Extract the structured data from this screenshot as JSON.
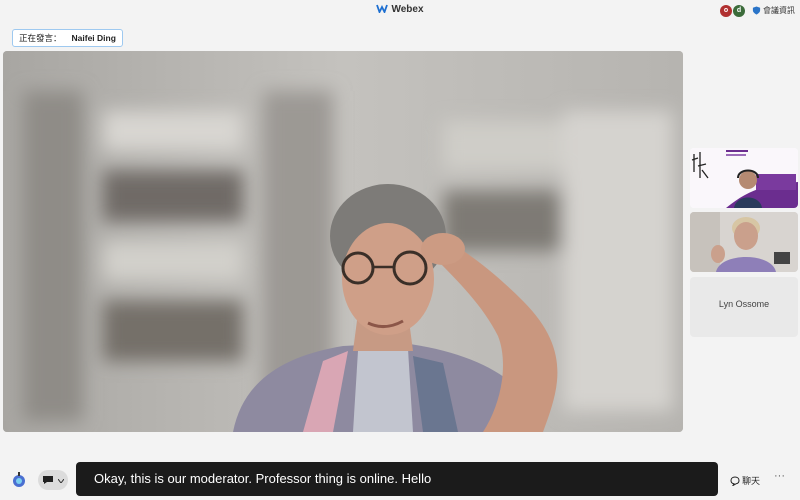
{
  "app": {
    "title": "Webex"
  },
  "header": {
    "avatars": [
      {
        "initial": "o",
        "color": "#b03030"
      },
      {
        "initial": "d",
        "color": "#3b6b3a"
      }
    ],
    "meeting_info_label": "會議資訊"
  },
  "speaking": {
    "label": "正在發言：",
    "name": "Naifei Ding"
  },
  "thumbnails": [
    {
      "kind": "video"
    },
    {
      "kind": "video"
    },
    {
      "kind": "name",
      "name": "Lyn Ossome"
    }
  ],
  "caption": {
    "text": "Okay, this is our moderator. Professor thing is online. Hello"
  },
  "controls": {
    "chat_label": "聊天",
    "more_label": "···"
  },
  "colors": {
    "accent": "#1d6fd1",
    "caption_bg": "#1b1b1b",
    "purple_slide": "#6b2d8f"
  }
}
